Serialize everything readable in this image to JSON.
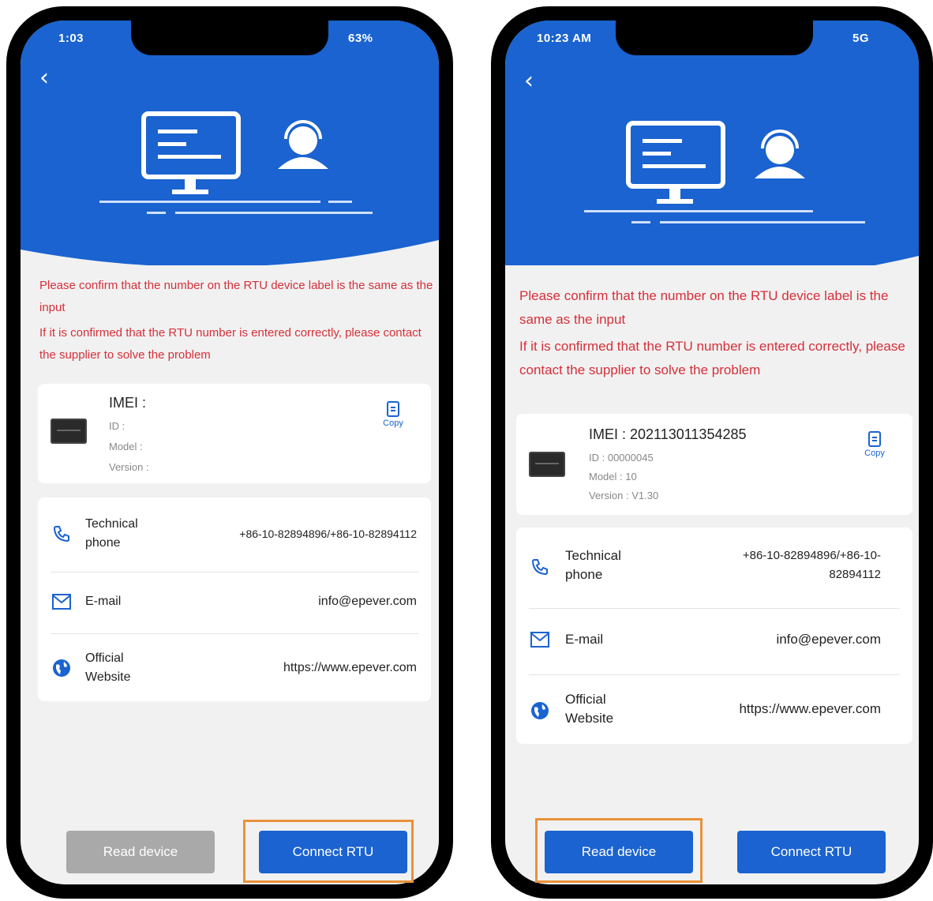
{
  "left_phone": {
    "status_time": "1:03",
    "status_battery": "63%",
    "message_line1": "Please confirm that the number on the RTU device label is the same as the input",
    "message_line2": "If it is confirmed that the RTU number is entered correctly, please contact the supplier to solve the problem",
    "device": {
      "imei": "IMEI :",
      "id": "ID :",
      "model": "Model :",
      "version": "Version :",
      "copy_label": "Copy"
    },
    "contacts": {
      "phone_label": "Technical phone",
      "phone_value": "+86-10-82894896/+86-10-82894112",
      "email_label": "E-mail",
      "email_value": "info@epever.com",
      "website_label": "Official Website",
      "website_value": "https://www.epever.com"
    },
    "buttons": {
      "read_device": "Read device",
      "connect_rtu": "Connect RTU"
    }
  },
  "right_phone": {
    "status_time": "10:23 AM",
    "status_right": "5G",
    "message_line1": "Please confirm that the number on the RTU device label is the same as the input",
    "message_line2": "If it is confirmed that the RTU number is entered correctly, please contact the supplier to solve the problem",
    "device": {
      "imei": "IMEI : 202113011354285",
      "id": "ID : 00000045",
      "model": "Model : 10",
      "version": "Version : V1.30",
      "copy_label": "Copy"
    },
    "contacts": {
      "phone_label": "Technical phone",
      "phone_value": "+86-10-82894896/+86-10-82894112",
      "email_label": "E-mail",
      "email_value": "info@epever.com",
      "website_label": "Official Website",
      "website_value": "https://www.epever.com"
    },
    "buttons": {
      "read_device": "Read device",
      "connect_rtu": "Connect RTU"
    }
  },
  "colors": {
    "brand_blue": "#1a63d0",
    "warning_red": "#d5303a",
    "disabled_gray": "#a9a9a9",
    "highlight_orange": "#e8923a"
  }
}
